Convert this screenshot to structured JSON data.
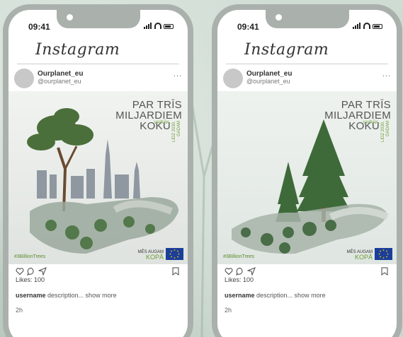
{
  "phones": [
    {
      "status_time": "09:41",
      "app_title": "Instagram",
      "post": {
        "username": "Ourplanet_eu",
        "handle": "@ourplanet_eu",
        "more": "...",
        "image": {
          "title_line1": "PAR TRĪS",
          "title_line2": "MILJARDIEM",
          "title_line3": "KOKU",
          "vert_text": "LĪDZ 2030. GADAM",
          "vaire": "VAIRĀK",
          "hashtag": "#3BillionTrees",
          "mes_augam": "MĒS AUGAM",
          "kopa": "KOPĀ"
        },
        "likes": "Likes: 100",
        "desc_user": "username",
        "desc_text": " description... show more",
        "time": "2h"
      }
    },
    {
      "status_time": "09:41",
      "app_title": "Instagram",
      "post": {
        "username": "Ourplanet_eu",
        "handle": "@ourplanet_eu",
        "more": "...",
        "image": {
          "title_line1": "PAR TRĪS",
          "title_line2": "MILJARDIEM",
          "title_line3": "KOKU",
          "vert_text": "LĪDZ 2030. GADAM",
          "vaire": "VAIRĀK",
          "hashtag": "#3BillionTrees",
          "mes_augam": "MĒS AUGAM",
          "kopa": "KOPĀ"
        },
        "likes": "Likes: 100",
        "desc_user": "username",
        "desc_text": " description... show more",
        "time": "2h"
      }
    }
  ],
  "colors": {
    "accent_green": "#6e9b3a",
    "eu_blue": "#1a3e9a",
    "phone_frame": "#aab1ad"
  }
}
